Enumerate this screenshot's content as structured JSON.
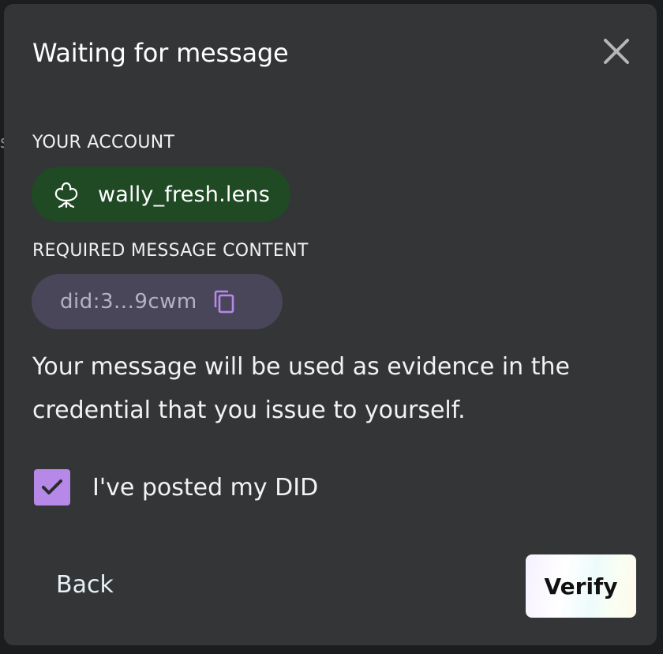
{
  "backdrop": {
    "partial_text": "s"
  },
  "modal": {
    "title": "Waiting for message",
    "close_icon": "close-icon"
  },
  "account": {
    "label": "YOUR ACCOUNT",
    "name": "wally_fresh.lens",
    "icon": "lens-protocol-icon",
    "pill_color": "#1f4a24"
  },
  "required_message": {
    "label": "REQUIRED MESSAGE CONTENT",
    "value": "did:3...9cwm",
    "copy_icon": "copy-icon",
    "pill_color": "#49465a",
    "icon_color": "#b689e8"
  },
  "description": "Your message will be used as evidence in the credential that you issue to yourself.",
  "confirmation": {
    "checked": true,
    "label": "I've posted my DID",
    "check_color": "#b689e8"
  },
  "actions": {
    "back_label": "Back",
    "verify_label": "Verify"
  }
}
